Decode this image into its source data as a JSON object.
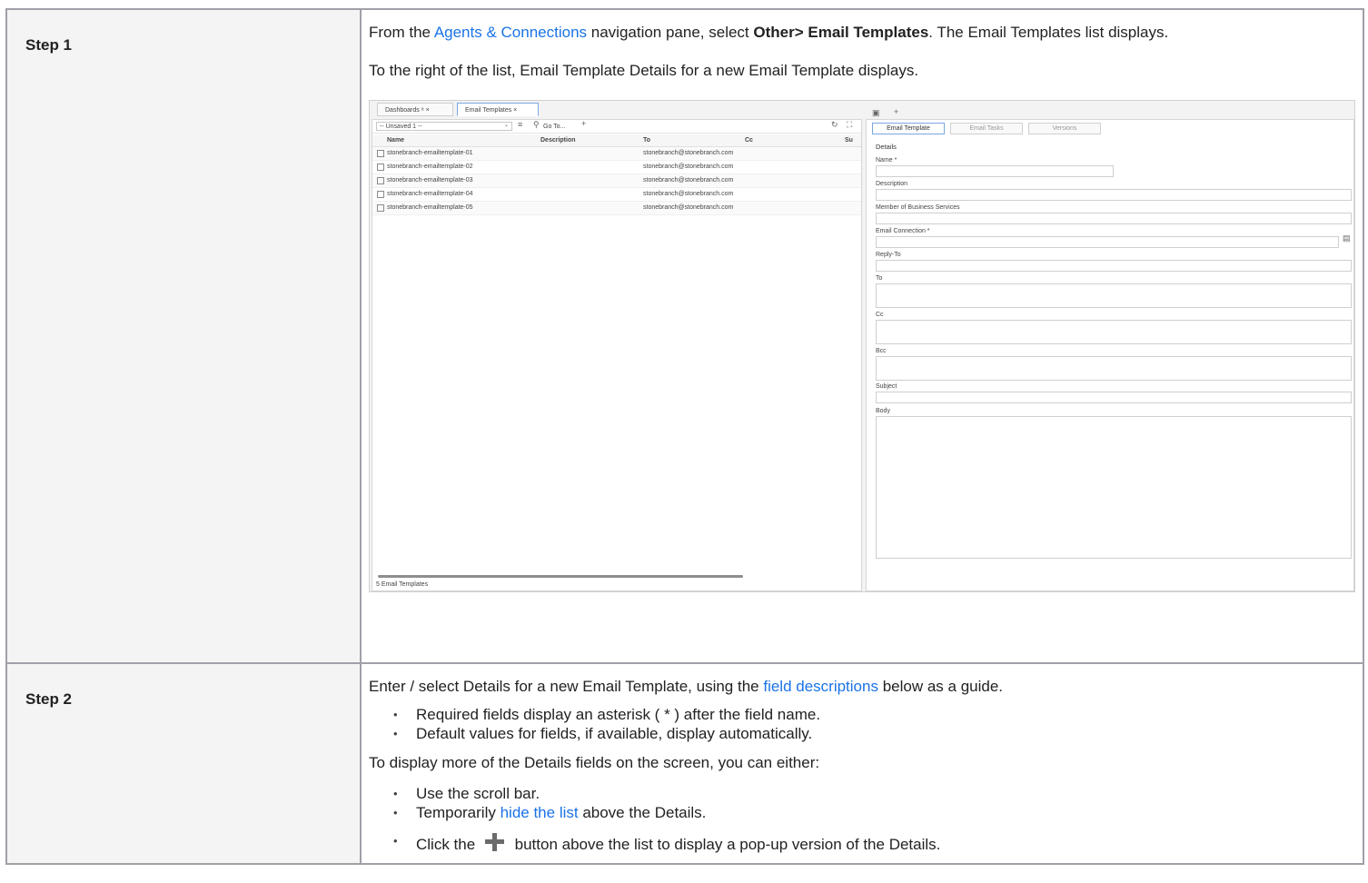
{
  "step1": {
    "label": "Step 1",
    "line1_pre": "From the ",
    "line1_link": "Agents & Connections",
    "line1_mid": " navigation pane, select ",
    "line1_bold": "Other> Email Templates",
    "line1_post": ". The Email Templates list displays.",
    "line2": "To the right of the list, Email Template Details for a new Email Template displays.",
    "screenshot": {
      "tabs": [
        {
          "label": "Dashboards ⁸ ×"
        },
        {
          "label": "Email Templates ×"
        }
      ],
      "list": {
        "filter_value": "-- Unsaved 1 --",
        "goto_label": "Go To...",
        "columns": [
          "Name",
          "Description",
          "To",
          "Cc",
          "Su"
        ],
        "rows": [
          {
            "name": "stonebranch-emailtemplate-01",
            "to": "stonebranch@stonebranch.com"
          },
          {
            "name": "stonebranch-emailtemplate-02",
            "to": "stonebranch@stonebranch.com"
          },
          {
            "name": "stonebranch-emailtemplate-03",
            "to": "stonebranch@stonebranch.com"
          },
          {
            "name": "stonebranch-emailtemplate-04",
            "to": "stonebranch@stonebranch.com"
          },
          {
            "name": "stonebranch-emailtemplate-05",
            "to": "stonebranch@stonebranch.com"
          }
        ],
        "footer": "5 Email Templates"
      },
      "details": {
        "tabs": [
          "Email Template",
          "Email Tasks",
          "Versions"
        ],
        "section": "Details",
        "fields": {
          "name": "Name *",
          "description": "Description",
          "member": "Member of Business Services",
          "connection": "Email Connection *",
          "reply_to": "Reply-To",
          "to": "To",
          "cc": "Cc",
          "bcc": "Bcc",
          "subject": "Subject",
          "body": "Body"
        }
      }
    }
  },
  "step2": {
    "label": "Step 2",
    "line1_pre": "Enter / select Details for a new Email Template, using the ",
    "line1_link": "field descriptions",
    "line1_post": " below as a guide.",
    "bullets1": [
      "Required fields display an asterisk ( * ) after the field name.",
      "Default values for fields, if available, display automatically."
    ],
    "line2": "To display more of the Details fields on the screen, you can either:",
    "bullet_scroll": "Use the scroll bar.",
    "bullet_hide_pre": "Temporarily ",
    "bullet_hide_link": "hide the list",
    "bullet_hide_post": " above the Details.",
    "bullet_click_pre": "Click the ",
    "bullet_click_post": " button above the list to display a pop-up version of the Details."
  }
}
